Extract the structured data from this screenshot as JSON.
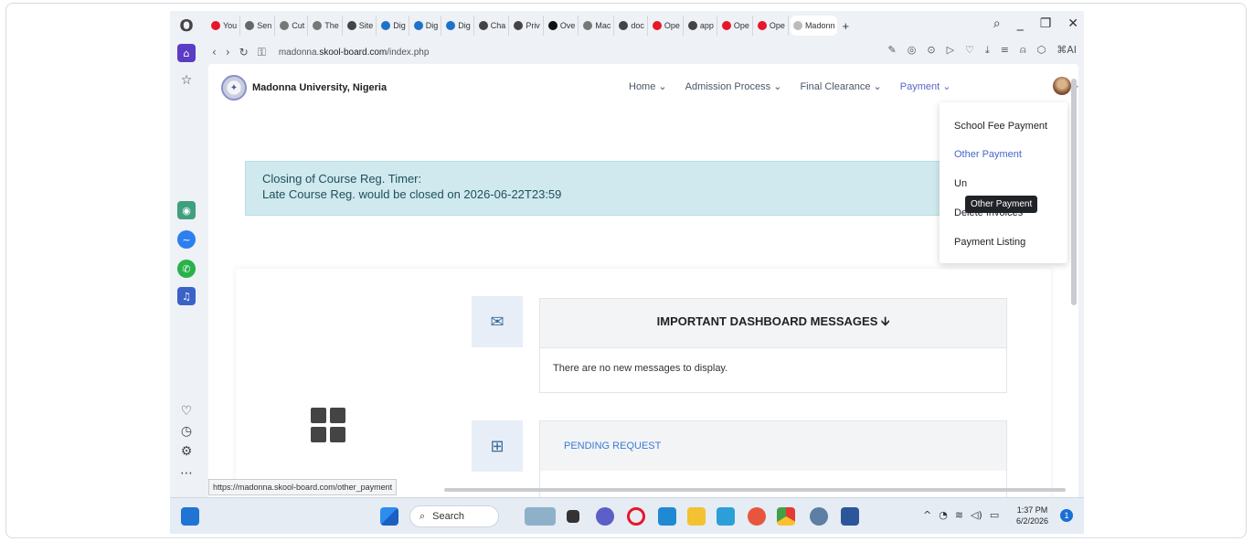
{
  "browser": {
    "tabs": [
      {
        "label": "You",
        "color": "#e5182a"
      },
      {
        "label": "Sen",
        "color": "#666"
      },
      {
        "label": "Cut",
        "color": "#777"
      },
      {
        "label": "The",
        "color": "#777"
      },
      {
        "label": "Site",
        "color": "#444"
      },
      {
        "label": "Dig",
        "color": "#1e73c8"
      },
      {
        "label": "Dig",
        "color": "#1e73c8"
      },
      {
        "label": "Dig",
        "color": "#1e73c8"
      },
      {
        "label": "Cha",
        "color": "#444"
      },
      {
        "label": "Priv",
        "color": "#444"
      },
      {
        "label": "Ove",
        "color": "#111"
      },
      {
        "label": "Mac",
        "color": "#777"
      },
      {
        "label": "doc",
        "color": "#444"
      },
      {
        "label": "Ope",
        "color": "#e5182a"
      },
      {
        "label": "app",
        "color": "#444"
      },
      {
        "label": "Ope",
        "color": "#e5182a"
      },
      {
        "label": "Ope",
        "color": "#e5182a"
      }
    ],
    "active_tab": "Madonn",
    "url_prefix": "madonna.",
    "url_domain": "skool-board.com",
    "url_path": "/index.php",
    "ai_label": "AI",
    "status_url": "https://madonna.skool-board.com/other_payment"
  },
  "site": {
    "brand_name": "Madonna University, Nigeria",
    "nav": {
      "home": "Home ⌄",
      "admission": "Admission Process ⌄",
      "clearance": "Final Clearance ⌄",
      "payment": "Payment ⌄"
    },
    "alert_line1": "Closing of Course Reg. Timer:",
    "alert_line2": "Late Course Reg. would be closed on 2026-06-22T23:59",
    "messages_title": "IMPORTANT DASHBOARD MESSAGES 🡫",
    "messages_body": "There are no new messages to display.",
    "pending_title": "PENDING REQUEST",
    "dropdown": [
      "School Fee Payment",
      "Other Payment",
      "Un",
      "Delete Invoices",
      "Payment Listing"
    ],
    "tooltip": "Other Payment"
  },
  "taskbar": {
    "search_label": "Search",
    "time": "1:37 PM",
    "date": "6/2/2026",
    "notif_count": "1"
  }
}
